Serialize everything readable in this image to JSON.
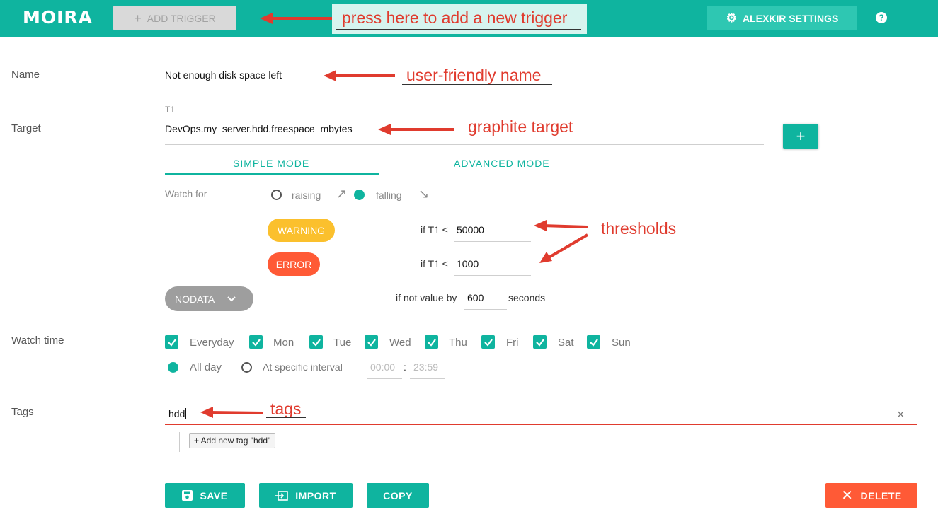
{
  "header": {
    "logo": "MOIRA",
    "add_trigger_label": "ADD TRIGGER",
    "settings_label": "ALEXKIR SETTINGS",
    "help": "?"
  },
  "callouts": {
    "add_trigger": "press here to add a new trigger",
    "name": "user-friendly name",
    "target": "graphite target",
    "thresholds": "thresholds",
    "tags": "tags"
  },
  "form": {
    "name_label": "Name",
    "name_value": "Not enough disk space left",
    "target_label": "Target",
    "target_tag": "T1",
    "target_value": "DevOps.my_server.hdd.freespace_mbytes",
    "add_target": "+",
    "tabs": {
      "simple": "SIMPLE MODE",
      "advanced": "ADVANCED MODE"
    },
    "watch_for_label": "Watch for",
    "raising": "raising",
    "falling": "falling",
    "warning_label": "WARNING",
    "error_label": "ERROR",
    "warning_cond": "if T1 ≤",
    "error_cond": "if T1 ≤",
    "warning_value": "50000",
    "error_value": "1000",
    "nodata_label": "NODATA",
    "nodata_prefix": "if not value by",
    "nodata_value": "600",
    "nodata_suffix": "seconds",
    "watch_time_label": "Watch time",
    "days": [
      "Everyday",
      "Mon",
      "Tue",
      "Wed",
      "Thu",
      "Fri",
      "Sat",
      "Sun"
    ],
    "all_day": "All day",
    "specific_interval": "At specific interval",
    "time_from": "00:00",
    "time_sep": ":",
    "time_to": "23:59",
    "tags_label": "Tags",
    "tags_value": "hdd",
    "tags_clear": "×",
    "add_tag_suggestion": "+ Add new tag \"hdd\""
  },
  "actions": {
    "save": "SAVE",
    "import": "IMPORT",
    "copy": "COPY",
    "delete": "DELETE"
  },
  "colors": {
    "primary": "#0fb49f",
    "warning": "#fbc02d",
    "error": "#ff5a36",
    "annotation": "#e03b2e"
  }
}
